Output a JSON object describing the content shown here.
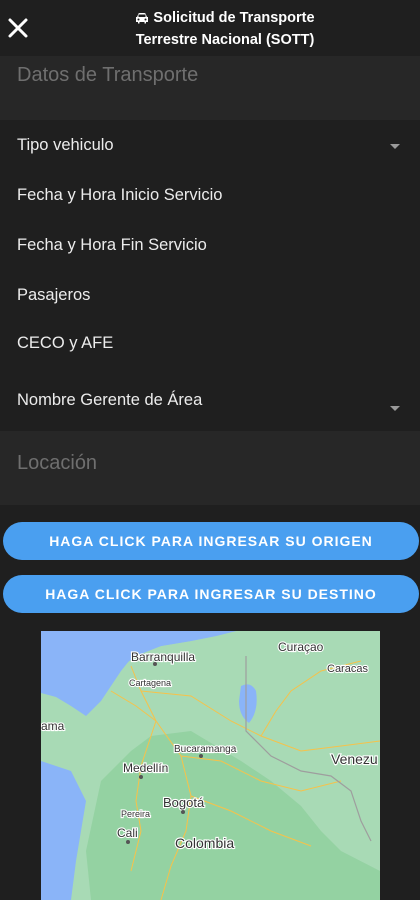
{
  "header": {
    "close_icon": "close-icon",
    "car_icon": "car-icon",
    "title_line1": "Solicitud de Transporte",
    "title_line2": "Terrestre Nacional (SOTT)"
  },
  "sections": {
    "transport_title": "Datos de Transporte",
    "location_title": "Locación"
  },
  "fields": {
    "vehicle_type": "Tipo vehiculo",
    "start_datetime": "Fecha y Hora Inicio Servicio",
    "end_datetime": "Fecha y Hora Fin Servicio",
    "passengers": "Pasajeros",
    "ceco_afe": "CECO y AFE",
    "area_manager": "Nombre Gerente de Área"
  },
  "buttons": {
    "origin": "HAGA CLICK PARA INGRESAR SU ORIGEN",
    "destination": "HAGA CLICK PARA INGRESAR SU DESTINO"
  },
  "map": {
    "places": {
      "curacao": "Curaçao",
      "barranquilla": "Barranquilla",
      "caracas": "Caracas",
      "cartagena": "Cartagena",
      "panama": "ama",
      "bucaramanga": "Bucaramanga",
      "medellin": "Medellín",
      "venezuela": "Venezu",
      "bogota": "Bogotá",
      "pereira": "Pereira",
      "cali": "Cali",
      "colombia": "Colombia"
    }
  },
  "colors": {
    "background": "#1f1f1f",
    "section_band": "#272727",
    "button": "#4a9ff0",
    "water": "#8ab4f8",
    "land": "#a8dab5"
  }
}
